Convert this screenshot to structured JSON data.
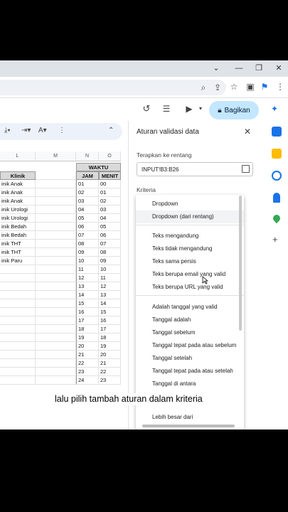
{
  "sheet_header": {
    "share_label": "Bagikan"
  },
  "grid": {
    "col_letters": [
      "L",
      "M",
      "N",
      "O"
    ],
    "klinik_header": "Klinik",
    "waktu_header": "WAKTU",
    "jam_header": "JAM",
    "menit_header": "MENIT",
    "klinik_values": [
      "inik Anak",
      "inik Anak",
      "inik Anak",
      "inik Urologi",
      "inik Urologi",
      "inik Bedah",
      "inik Bedah",
      "inik THT",
      "inik THT",
      "inik Paru"
    ],
    "jam_values": [
      "01",
      "02",
      "03",
      "04",
      "05",
      "06",
      "07",
      "08",
      "09",
      "10",
      "11",
      "12",
      "13",
      "14",
      "15",
      "16",
      "17",
      "18",
      "19",
      "20",
      "21",
      "22",
      "23",
      "24"
    ],
    "menit_values": [
      "00",
      "01",
      "02",
      "03",
      "04",
      "05",
      "06",
      "07",
      "08",
      "09",
      "10",
      "11",
      "12",
      "13",
      "14",
      "15",
      "16",
      "17",
      "18",
      "19",
      "20",
      "21",
      "22",
      "23"
    ]
  },
  "panel": {
    "title": "Aturan validasi data",
    "range_label": "Terapkan ke rentang",
    "range_value": "INPUT!B3:B26",
    "criteria_label": "Kriteria"
  },
  "dropdown": {
    "group1": [
      "Dropdown",
      "Dropdown (dari rentang)"
    ],
    "group2": [
      "Teks mengandung",
      "Teks tidak mengandung",
      "Teks sama persis",
      "Teks berupa email yang valid",
      "Teks berupa URL yang valid"
    ],
    "group3": [
      "Adalah tanggal yang valid",
      "Tanggal adalah",
      "Tanggal sebelum",
      "Tanggal tepat pada atau sebelum",
      "Tanggal setelah",
      "Tanggal tepat pada atau setelah",
      "Tanggal di antara"
    ],
    "group4": [
      "Lebih besar dari"
    ]
  },
  "caption": "lalu pilih tambah aturan dalam kriteria",
  "colors": {
    "accent": "#c2e7ff",
    "header_fill": "#d9d9d9"
  }
}
